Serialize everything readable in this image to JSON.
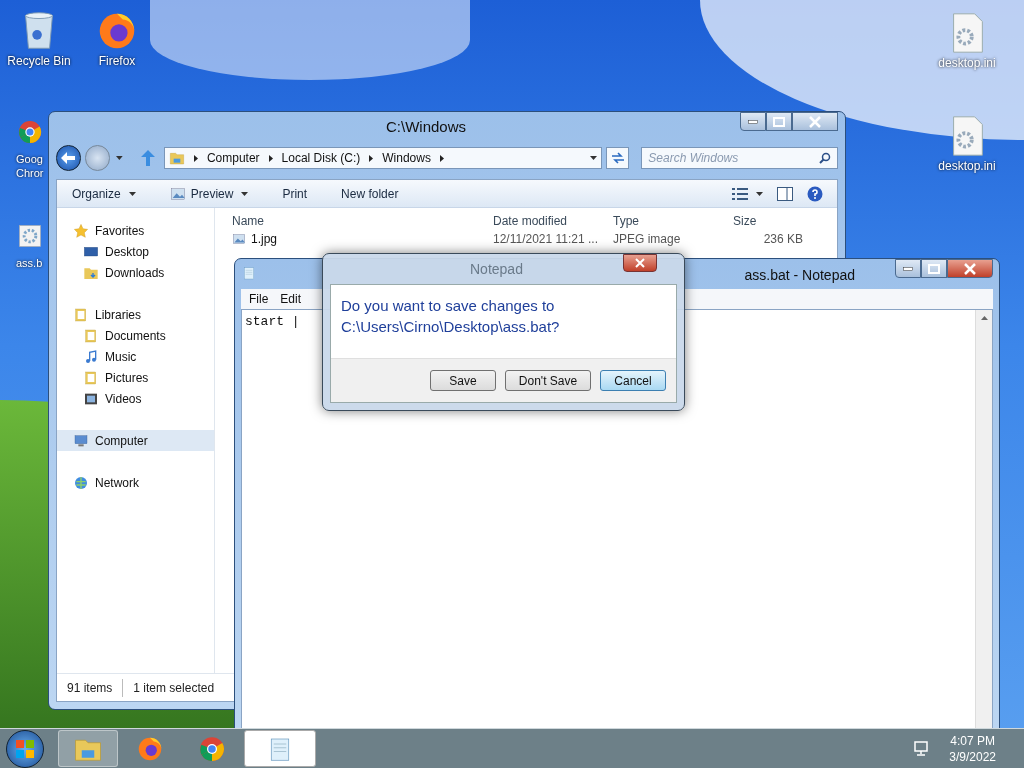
{
  "desktop_icons": [
    {
      "label": "Recycle Bin",
      "kind": "recycle"
    },
    {
      "label": "Firefox",
      "kind": "firefox"
    },
    {
      "label": "Goog Chror",
      "kind": "chrome"
    },
    {
      "label": "ass.b",
      "kind": "script"
    },
    {
      "label": "desktop.ini",
      "kind": "ini"
    },
    {
      "label": "desktop.ini",
      "kind": "ini"
    }
  ],
  "explorer": {
    "title": "C:\\Windows",
    "breadcrumb": [
      "Computer",
      "Local Disk (C:)",
      "Windows"
    ],
    "search": {
      "placeholder": "Search Windows"
    },
    "toolbar": [
      {
        "label": "Organize",
        "dropdown": true,
        "kind": "text"
      },
      {
        "label": "Preview",
        "dropdown": true,
        "kind": "preview"
      },
      {
        "label": "Print",
        "dropdown": false,
        "kind": "text"
      },
      {
        "label": "New folder",
        "dropdown": false,
        "kind": "text"
      }
    ],
    "nav": [
      {
        "label": "Favorites",
        "kind": "star",
        "selected": false,
        "children": [
          {
            "label": "Desktop",
            "kind": "desktop",
            "selected": false
          },
          {
            "label": "Downloads",
            "kind": "downloads",
            "selected": false
          }
        ]
      },
      {
        "label": "Libraries",
        "kind": "libraries",
        "selected": false,
        "children": [
          {
            "label": "Documents",
            "kind": "documents",
            "selected": false
          },
          {
            "label": "Music",
            "kind": "music",
            "selected": false
          },
          {
            "label": "Pictures",
            "kind": "pictures",
            "selected": false
          },
          {
            "label": "Videos",
            "kind": "videos",
            "selected": false
          }
        ]
      },
      {
        "label": "Computer",
        "kind": "computer",
        "selected": true
      },
      {
        "label": "Network",
        "kind": "network",
        "selected": false
      }
    ],
    "columns": [
      "Name",
      "Date modified",
      "Type",
      "Size"
    ],
    "rows": [
      {
        "name": "1.jpg",
        "date": "12/11/2021 11:21 ...",
        "type": "JPEG image",
        "size": "236 KB"
      }
    ],
    "status": [
      "91 items",
      "1 item selected"
    ]
  },
  "notepad": {
    "title": "ass.bat - Notepad",
    "menu": [
      "File",
      "Edit"
    ],
    "text": "start |"
  },
  "dialog": {
    "title": "Notepad",
    "message": "Do you want to save changes to C:\\Users\\Cirno\\Desktop\\ass.bat?",
    "buttons": [
      {
        "label": "Save",
        "focused": false
      },
      {
        "label": "Don't Save",
        "focused": false
      },
      {
        "label": "Cancel",
        "focused": true
      }
    ]
  },
  "taskbar": {
    "apps": [
      {
        "kind": "explorer",
        "active": true
      },
      {
        "kind": "firefox",
        "active": false
      },
      {
        "kind": "chrome",
        "active": false
      },
      {
        "kind": "notepad",
        "active": true
      }
    ],
    "time": "4:07 PM",
    "date": "3/9/2022"
  }
}
